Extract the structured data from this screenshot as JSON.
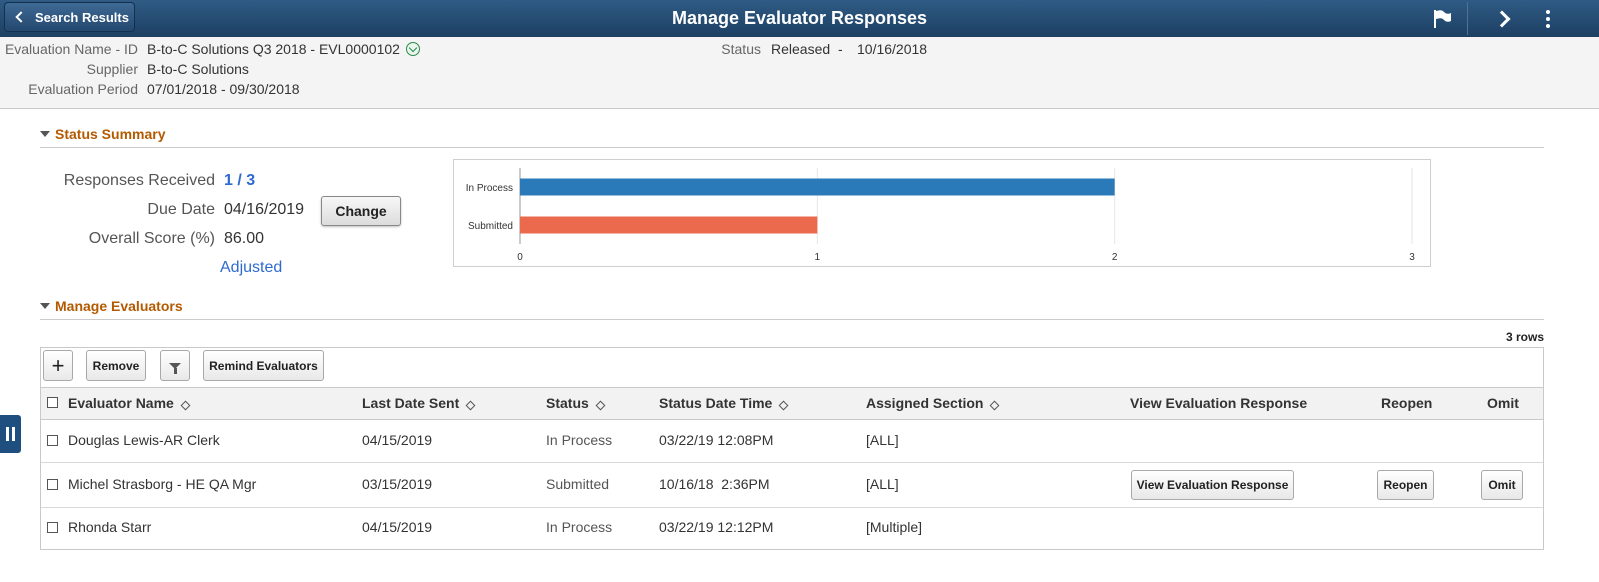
{
  "banner": {
    "back_label": "Search Results",
    "title": "Manage Evaluator Responses"
  },
  "header": {
    "eval_name_label": "Evaluation Name - ID",
    "eval_name_value": "B-to-C Solutions Q3 2018 - EVL0000102",
    "supplier_label": "Supplier",
    "supplier_value": "B-to-C Solutions",
    "period_label": "Evaluation Period",
    "period_value": "07/01/2018 -  09/30/2018",
    "status_label": "Status",
    "status_value": "Released",
    "status_dash": "-",
    "status_date": "10/16/2018"
  },
  "summary": {
    "section_title": "Status Summary",
    "responses_label": "Responses Received",
    "responses_value": "1 / 3",
    "due_date_label": "Due Date",
    "due_date_value": "04/16/2019",
    "change_label": "Change",
    "score_label": "Overall Score (%)",
    "score_value": "86.00",
    "adjusted_label": "Adjusted"
  },
  "chart_data": {
    "type": "bar",
    "orientation": "horizontal",
    "categories": [
      "In Process",
      "Submitted"
    ],
    "values": [
      2,
      1
    ],
    "colors": [
      "#2a7ab9",
      "#eb6a4d"
    ],
    "xlim": [
      0,
      3
    ],
    "xticks": [
      "0",
      "1",
      "2",
      "3"
    ],
    "grid": true
  },
  "evaluators": {
    "section_title": "Manage Evaluators",
    "rows_count": "3 rows",
    "toolbar": {
      "add_symbol": "+",
      "remove_label": "Remove",
      "remind_label": "Remind Evaluators"
    },
    "columns": [
      "Evaluator Name",
      "Last Date Sent",
      "Status",
      "Status Date Time",
      "Assigned Section",
      "View Evaluation Response",
      "Reopen",
      "Omit"
    ],
    "rows": [
      {
        "name": "Douglas Lewis-AR Clerk",
        "sent": "04/15/2019",
        "status": "In Process",
        "datetime": "03/22/19 12:08PM",
        "section": "[ALL]",
        "view": "",
        "reopen": "",
        "omit": ""
      },
      {
        "name": "Michel Strasborg - HE QA Mgr",
        "sent": "03/15/2019",
        "status": "Submitted",
        "datetime": "10/16/18  2:36PM",
        "section": "[ALL]",
        "view": "View Evaluation Response",
        "reopen": "Reopen",
        "omit": "Omit"
      },
      {
        "name": "Rhonda Starr",
        "sent": "04/15/2019",
        "status": "In Process",
        "datetime": "03/22/19 12:12PM",
        "section": "[Multiple]",
        "view": "",
        "reopen": "",
        "omit": ""
      }
    ]
  },
  "icons": [
    "chevron-left-icon",
    "flag-icon",
    "chevron-right-icon",
    "more-vertical-icon",
    "expand-down-icon",
    "collapse-triangle-icon",
    "add-icon",
    "filter-icon",
    "sort-icon",
    "pause-icon"
  ]
}
